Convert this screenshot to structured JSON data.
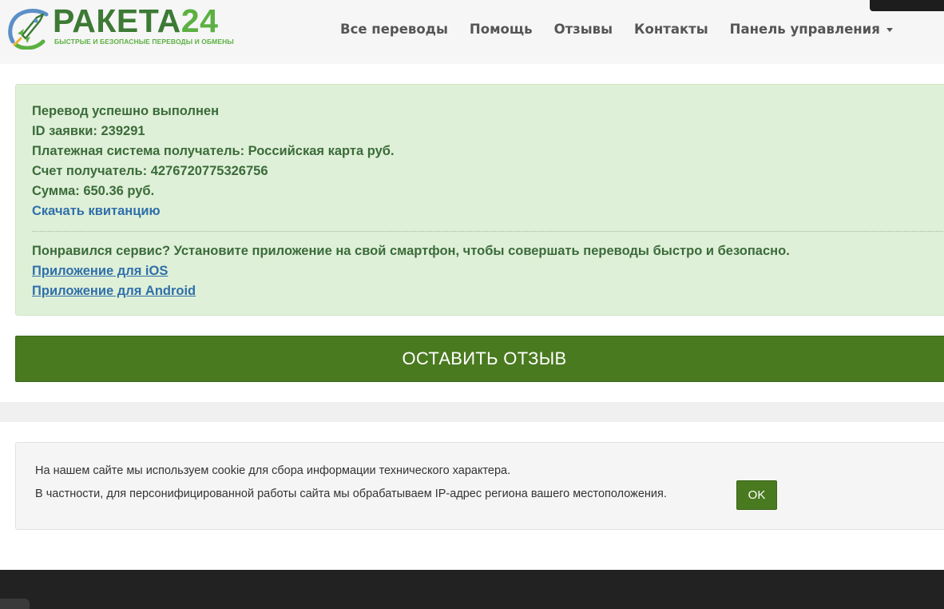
{
  "header": {
    "logo_title": "РАКЕТА",
    "logo_number": "24",
    "logo_subtitle": "БЫСТРЫЕ И БЕЗОПАСНЫЕ ПЕРЕВОДЫ И ОБМЕНЫ",
    "nav": [
      {
        "label": "Все переводы"
      },
      {
        "label": "Помощь"
      },
      {
        "label": "Отзывы"
      },
      {
        "label": "Контакты"
      },
      {
        "label": "Панель управления"
      }
    ]
  },
  "alert": {
    "status": "Перевод успешно выполнен",
    "order_id": "ID заявки: 239291",
    "payment_system": "Платежная система получатель: Российская карта руб.",
    "account": "Счет получатель: 4276720775326756",
    "amount": "Сумма: 650.36 руб.",
    "download_receipt": "Скачать квитанцию",
    "promo": "Понравился сервис? Установите приложение на свой смартфон, чтобы совершать переводы быстро и безопасно.",
    "ios_link": "Приложение для iOS",
    "android_link": "Приложение для Android"
  },
  "review_button": "ОСТАВИТЬ ОТЗЫВ",
  "cookie": {
    "line1": "На нашем сайте мы используем cookie для сбора информации технического характера.",
    "line2": "В частности, для персонифицированной работы сайта мы обрабатываем IP-адрес региона вашего местоположения.",
    "ok": "OK"
  },
  "colors": {
    "brand_green": "#4a7a20",
    "alert_bg": "#dff0d8",
    "alert_text": "#3b6b3a",
    "link": "#2f6faa",
    "footer": "#222222"
  }
}
